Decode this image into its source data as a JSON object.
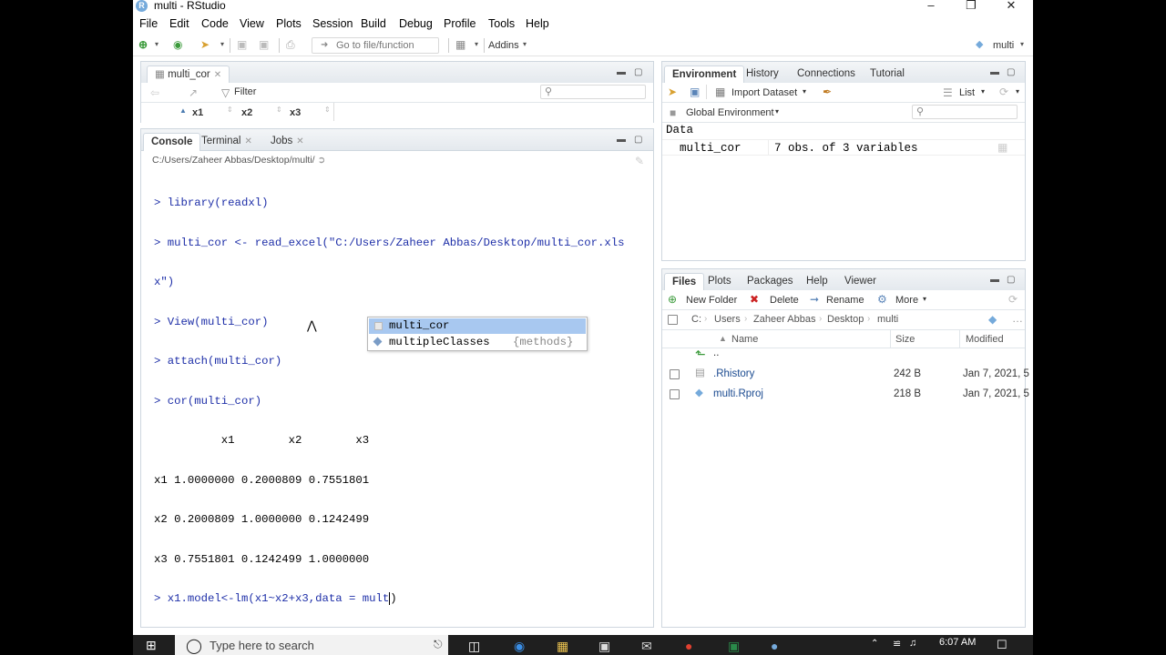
{
  "window": {
    "title": "multi - RStudio",
    "app_icon": "R"
  },
  "menu": [
    "File",
    "Edit",
    "Code",
    "View",
    "Plots",
    "Session",
    "Build",
    "Debug",
    "Profile",
    "Tools",
    "Help"
  ],
  "toolbar": {
    "goto_placeholder": "Go to file/function",
    "addins": "Addins",
    "project": "multi"
  },
  "source": {
    "tab": "multi_cor",
    "filter": "Filter",
    "columns": [
      "x1",
      "x2",
      "x3"
    ]
  },
  "console": {
    "tabs": [
      "Console",
      "Terminal",
      "Jobs"
    ],
    "path": "C:/Users/Zaheer Abbas/Desktop/multi/",
    "lines": [
      {
        "prompt": "> ",
        "text": "library(readxl)"
      },
      {
        "prompt": "> ",
        "text": "multi_cor <- read_excel(\"C:/Users/Zaheer Abbas/Desktop/multi_cor.xls"
      },
      {
        "prompt": "",
        "text": "x\")"
      },
      {
        "prompt": "> ",
        "text": "View(multi_cor)"
      },
      {
        "prompt": "> ",
        "text": "attach(multi_cor)"
      },
      {
        "prompt": "> ",
        "text": "cor(multi_cor)"
      }
    ],
    "output": [
      "          x1        x2        x3",
      "x1 1.0000000 0.2000809 0.7551801",
      "x2 0.2000809 1.0000000 0.1242499",
      "x3 0.7551801 0.1242499 1.0000000"
    ],
    "current_prompt": "> ",
    "current_input": "x1.model<-lm(x1~x2+x3,data = mult",
    "autocomplete": [
      {
        "name": "multi_cor",
        "context": ""
      },
      {
        "name": "multipleClasses",
        "context": "{methods}"
      }
    ]
  },
  "environment": {
    "tabs": [
      "Environment",
      "History",
      "Connections",
      "Tutorial"
    ],
    "import_label": "Import Dataset",
    "view_mode": "List",
    "scope": "Global Environment",
    "section": "Data",
    "rows": [
      {
        "name": "multi_cor",
        "value": "7 obs. of 3 variables"
      }
    ]
  },
  "files": {
    "tabs": [
      "Files",
      "Plots",
      "Packages",
      "Help",
      "Viewer"
    ],
    "actions": [
      "New Folder",
      "Delete",
      "Rename",
      "More"
    ],
    "breadcrumb": [
      "C:",
      "Users",
      "Zaheer Abbas",
      "Desktop",
      "multi"
    ],
    "headers": [
      "Name",
      "Size",
      "Modified"
    ],
    "up_label": "..",
    "rows": [
      {
        "name": ".Rhistory",
        "size": "242 B",
        "modified": "Jan 7, 2021, 5"
      },
      {
        "name": "multi.Rproj",
        "size": "218 B",
        "modified": "Jan 7, 2021, 5"
      }
    ]
  },
  "taskbar": {
    "search_placeholder": "Type here to search",
    "time": "6:07 AM"
  },
  "colors": {
    "accent": "#75aadb",
    "selection": "#a8c8f0",
    "command": "#1e2fa8"
  }
}
